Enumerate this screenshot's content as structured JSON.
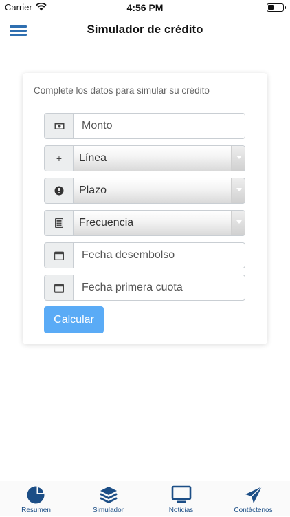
{
  "status_bar": {
    "carrier": "Carrier",
    "time": "4:56 PM",
    "battery_level": 0.4
  },
  "nav": {
    "title": "Simulador de crédito",
    "menu_icon": "hamburger-menu-icon"
  },
  "form": {
    "subtitle": "Complete los datos para simular su crédito",
    "fields": [
      {
        "icon": "money-icon",
        "type": "input",
        "placeholder": "Monto"
      },
      {
        "icon": "plus-icon",
        "type": "select",
        "value": "Línea",
        "addon_text": "+"
      },
      {
        "icon": "exclamation-circle-icon",
        "type": "select",
        "value": "Plazo"
      },
      {
        "icon": "calculator-icon",
        "type": "select",
        "value": "Frecuencia"
      },
      {
        "icon": "calendar-icon",
        "type": "input",
        "placeholder": "Fecha desembolso"
      },
      {
        "icon": "calendar-icon",
        "type": "input",
        "placeholder": "Fecha primera cuota"
      }
    ],
    "submit_label": "Calcular"
  },
  "tabs": [
    {
      "label": "Resumen",
      "icon": "pie-chart-icon"
    },
    {
      "label": "Simulador",
      "icon": "layers-icon"
    },
    {
      "label": "Noticias",
      "icon": "monitor-icon"
    },
    {
      "label": "Contáctenos",
      "icon": "send-icon"
    }
  ],
  "colors": {
    "accent": "#2f6fb0",
    "tab_icon": "#1c4e86",
    "button": "#5aabf6",
    "addon_bg": "#eceeef"
  }
}
